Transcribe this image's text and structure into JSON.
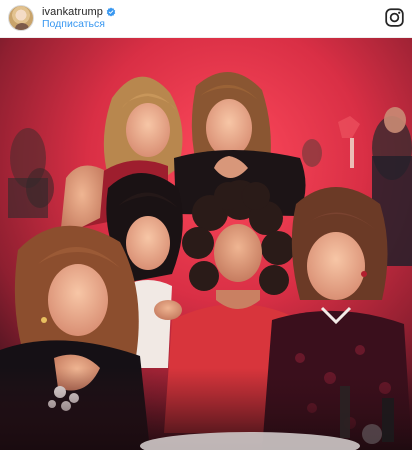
{
  "post": {
    "username": "ivankatrump",
    "verified": true,
    "follow_label": "Подписаться",
    "header_icons": {
      "avatar": "profile-avatar",
      "verified": "verified-badge-icon",
      "logo": "instagram-logo-icon"
    },
    "photo": {
      "subject": "group-photo"
    }
  },
  "colors": {
    "link": "#3897f0",
    "verified": "#3897f0",
    "text": "#262626",
    "header_bg": "#ffffff"
  }
}
